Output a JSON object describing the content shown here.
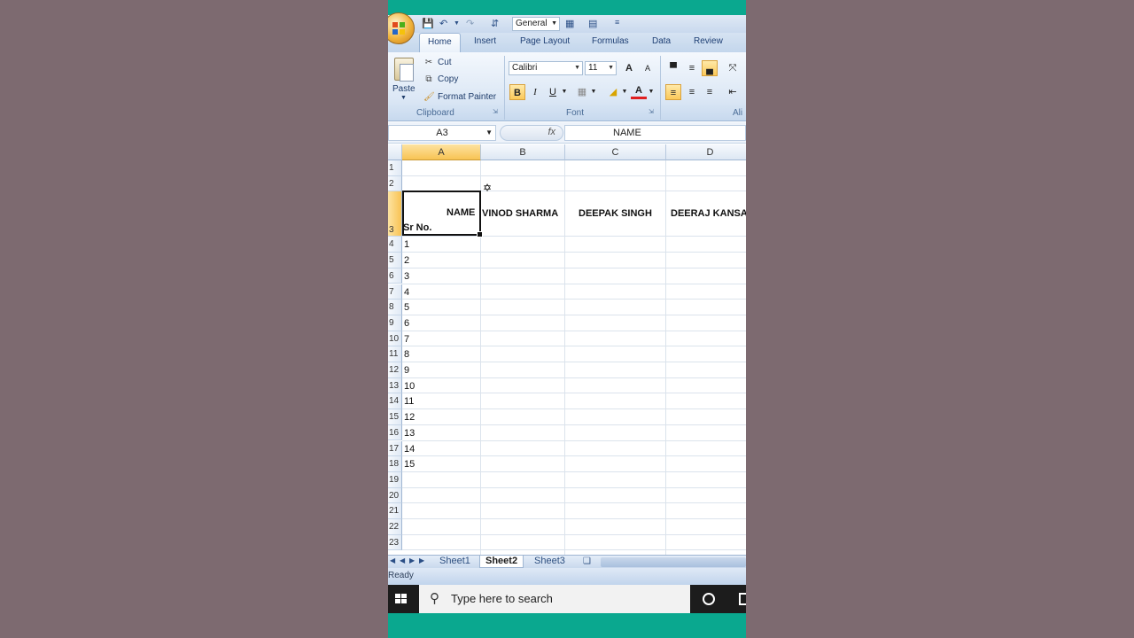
{
  "qat": {
    "number_format": "General"
  },
  "tabs": [
    "Home",
    "Insert",
    "Page Layout",
    "Formulas",
    "Data",
    "Review"
  ],
  "ribbon": {
    "clipboard": {
      "paste": "Paste",
      "cut": "Cut",
      "copy": "Copy",
      "format_painter": "Format Painter",
      "label": "Clipboard"
    },
    "font": {
      "name": "Calibri",
      "size": "11",
      "label": "Font",
      "bold": "B",
      "italic": "I",
      "underline": "U",
      "grow": "A",
      "shrink": "A",
      "font_color": "A"
    },
    "alignment": {
      "label": "Ali"
    }
  },
  "formula_bar": {
    "name_box": "A3",
    "fx": "fx",
    "content": "NAME"
  },
  "columns": [
    "A",
    "B",
    "C",
    "D"
  ],
  "rows": [
    "1",
    "2",
    "3",
    "4",
    "5",
    "6",
    "7",
    "8",
    "9",
    "10",
    "11",
    "12",
    "13",
    "14",
    "15",
    "16",
    "17",
    "18",
    "19",
    "20",
    "21",
    "22",
    "23"
  ],
  "cells": {
    "a3_top": "NAME",
    "a3_bottom": "Sr No.",
    "b3": "VINOD SHARMA",
    "c3": "DEEPAK SINGH",
    "d3": "DEERAJ KANSAL",
    "serials": [
      "1",
      "2",
      "3",
      "4",
      "5",
      "6",
      "7",
      "8",
      "9",
      "10",
      "11",
      "12",
      "13",
      "14",
      "15"
    ]
  },
  "sheets": [
    "Sheet1",
    "Sheet2",
    "Sheet3"
  ],
  "active_sheet": "Sheet2",
  "status": "Ready",
  "taskbar": {
    "search_placeholder": "Type here to search"
  },
  "colors": {
    "accent_teal": "#0aa88f",
    "selected_header": "#f8c354",
    "ribbon_blue": "#dbe7f5"
  }
}
